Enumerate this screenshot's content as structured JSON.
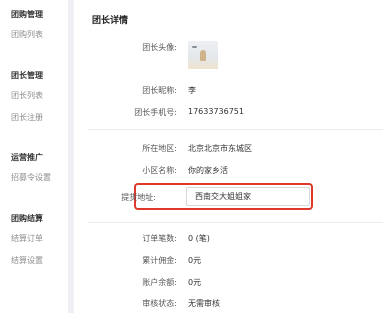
{
  "sidebar": {
    "groups": [
      {
        "title": "团购管理",
        "items": [
          "团购列表"
        ]
      },
      {
        "title": "团长管理",
        "items": [
          "团长列表",
          "团长注册"
        ]
      },
      {
        "title": "运营推广",
        "items": [
          "招募令设置"
        ]
      },
      {
        "title": "团购结算",
        "items": [
          "结算订单",
          "结算设置"
        ]
      }
    ]
  },
  "panel": {
    "title": "团长详情"
  },
  "leader": {
    "avatar_label": "团长头像:",
    "nickname_label": "团长昵称:",
    "nickname": "李",
    "phone_label": "团长手机号:",
    "phone": "17633736751"
  },
  "location": {
    "region_label": "所在地区:",
    "region": "北京北京市东城区",
    "community_label": "小区名称:",
    "community": "你的家乡活",
    "pickup_label": "提货地址:",
    "pickup_value": "西南交大姐姐家"
  },
  "stats": {
    "orders_label": "订单笔数:",
    "orders": "0 (笔)",
    "commission_label": "累计佣金:",
    "commission": "0元",
    "balance_label": "账户余额:",
    "balance": "0元",
    "review_label": "审核状态:",
    "review": "无需审核"
  },
  "colors": {
    "highlight": "#e0392b",
    "sidebar_bg": "#ffffff",
    "page_bg": "#f0f2f5"
  }
}
